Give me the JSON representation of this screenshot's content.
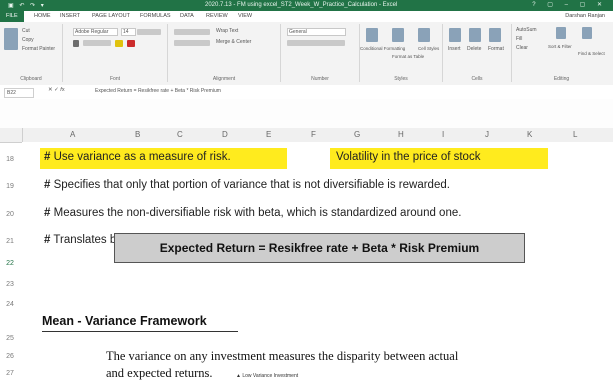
{
  "window": {
    "title": "2020.7.13 - FM using excel_ST2_Week_W_Practice_Calculation - Excel",
    "user": "Darshan Ranjan"
  },
  "ribbon_tabs": [
    "FILE",
    "HOME",
    "INSERT",
    "PAGE LAYOUT",
    "FORMULAS",
    "DATA",
    "REVIEW",
    "VIEW"
  ],
  "ribbon": {
    "cut": "Cut",
    "copy": "Copy",
    "format_painter": "Format Painter",
    "font_name": "Adobe Regular",
    "font_size": "14",
    "wrap_text": "Wrap Text",
    "merge_center": "Merge & Center",
    "number_format": "General",
    "conditional_formatting": "Conditional Formatting",
    "format_as_table": "Format as Table",
    "cell_styles": "Cell Styles",
    "insert": "Insert",
    "delete": "Delete",
    "format": "Format",
    "autosum": "AutoSum",
    "fill": "Fill",
    "clear": "Clear",
    "sort_filter": "Sort & Filter",
    "find_select": "Find & Select",
    "groups": [
      "Clipboard",
      "Font",
      "Alignment",
      "Number",
      "Styles",
      "Cells",
      "Editing"
    ]
  },
  "formula_bar": {
    "cell_ref": "B22",
    "formula": "Expected Return = Resikfree rate + Beta * Risk Premium"
  },
  "columns": [
    "A",
    "B",
    "C",
    "D",
    "E",
    "F",
    "G",
    "H",
    "I",
    "J",
    "K",
    "L"
  ],
  "rows": [
    "18",
    "19",
    "20",
    "21",
    "22",
    "23",
    "24",
    "25",
    "26",
    "27"
  ],
  "content": {
    "hash": "#",
    "r18_left": "Use variance as a measure of risk.",
    "r18_right": "Volatility in the price of stock",
    "r19": "Specifies that only that portion of variance that is not diversifiable is rewarded.",
    "r20": "Measures the non-diversifiable risk with beta, which is standardized around one.",
    "r21": "Translates beta into expected return:",
    "formula_box": "Expected Return = Resikfree rate + Beta * Risk Premium",
    "heading": "Mean - Variance Framework",
    "body_line1": "The variance on any investment measures the disparity between actual",
    "body_line2": "and expected returns.",
    "legend": "Low Variance Investment"
  },
  "colors": {
    "excel_green": "#217346",
    "highlight": "#ffeb1e",
    "formula_box_fill": "#cdcdcd"
  }
}
